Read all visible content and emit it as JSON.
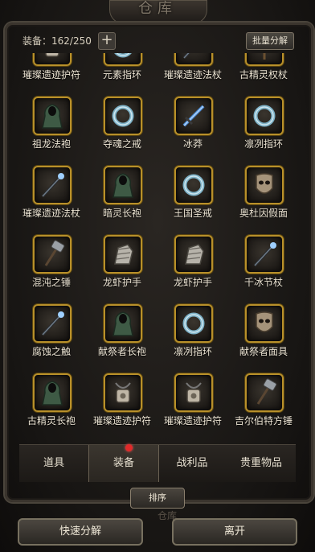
{
  "window": {
    "title": "仓库",
    "subtitle": "仓库"
  },
  "header": {
    "capacity_label": "装备：162/250",
    "plus_icon": "plus-icon",
    "bulk_button": "批量分解"
  },
  "items": [
    {
      "name": "璀璨遗迹护符",
      "icon": "amulet-icon"
    },
    {
      "name": "元素指环",
      "icon": "ring-icon"
    },
    {
      "name": "璀璨遗迹法杖",
      "icon": "staff-icon"
    },
    {
      "name": "古精灵权杖",
      "icon": "scepter-icon"
    },
    {
      "name": "祖龙法袍",
      "icon": "robe-icon"
    },
    {
      "name": "夺魂之戒",
      "icon": "ring-icon"
    },
    {
      "name": "冰莽",
      "icon": "sword-icon"
    },
    {
      "name": "凛冽指环",
      "icon": "ring-icon"
    },
    {
      "name": "璀璨遗迹法杖",
      "icon": "staff-icon"
    },
    {
      "name": "暗灵长袍",
      "icon": "robe-icon"
    },
    {
      "name": "王国圣戒",
      "icon": "ring-icon"
    },
    {
      "name": "奥杜因假面",
      "icon": "mask-icon"
    },
    {
      "name": "混沌之锤",
      "icon": "hammer-icon"
    },
    {
      "name": "龙虾护手",
      "icon": "gauntlet-icon"
    },
    {
      "name": "龙虾护手",
      "icon": "gauntlet-icon"
    },
    {
      "name": "千冰节杖",
      "icon": "staff-icon"
    },
    {
      "name": "腐蚀之触",
      "icon": "staff-icon"
    },
    {
      "name": "献祭者长袍",
      "icon": "robe-icon"
    },
    {
      "name": "凛冽指环",
      "icon": "ring-icon"
    },
    {
      "name": "献祭者面具",
      "icon": "mask-icon"
    },
    {
      "name": "古精灵长袍",
      "icon": "robe-icon"
    },
    {
      "name": "璀璨遗迹护符",
      "icon": "amulet-icon"
    },
    {
      "name": "璀璨遗迹护符",
      "icon": "amulet-icon"
    },
    {
      "name": "吉尔伯特方锤",
      "icon": "hammer-icon"
    },
    {
      "name": "",
      "icon": "amulet-icon"
    },
    {
      "name": "",
      "icon": "amulet-icon"
    },
    {
      "name": "",
      "icon": "amulet-icon"
    },
    {
      "name": "",
      "icon": "robe-icon"
    }
  ],
  "tabs": [
    {
      "label": "道具",
      "active": false
    },
    {
      "label": "装备",
      "active": true
    },
    {
      "label": "战利品",
      "active": false
    },
    {
      "label": "贵重物品",
      "active": false
    }
  ],
  "sort_button": "排序",
  "footer": {
    "left_button": "快速分解",
    "right_button": "离开"
  },
  "colors": {
    "slot_border": "#b8902a",
    "text": "#ece4d3",
    "badge": "#e02a2a"
  }
}
